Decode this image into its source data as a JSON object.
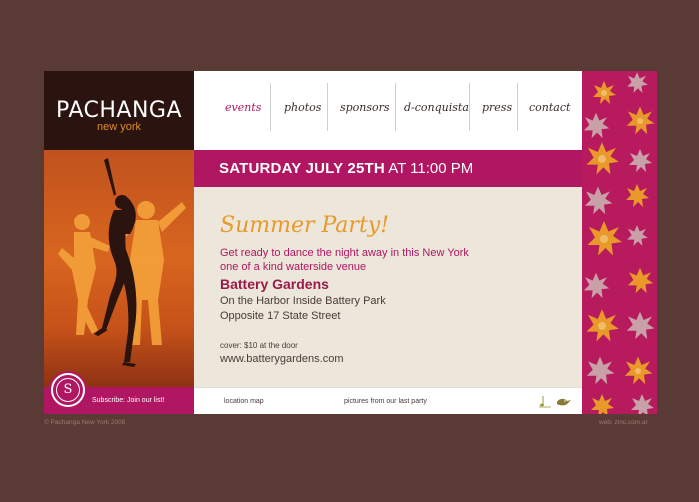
{
  "logo": {
    "title": "PACHANGA",
    "subtitle": "new york"
  },
  "nav": {
    "items": [
      {
        "label": "events"
      },
      {
        "label": "photos"
      },
      {
        "label": "sponsors"
      },
      {
        "label": "d-conquista"
      },
      {
        "label": "press"
      },
      {
        "label": "contact"
      }
    ],
    "active": "events"
  },
  "event": {
    "date": "SATURDAY JULY 25TH",
    "time": "AT 11:00 PM",
    "title": "Summer Party!",
    "intro_line1": "Get ready to dance the night away in this New York",
    "intro_line2": "one of a kind waterside venue",
    "venue": "Battery Gardens",
    "address_line1": "On the Harbor Inside Battery Park",
    "address_line2": "Opposite 17 State Street",
    "cover": "cover: $10 at the door",
    "website": "www.batterygardens.com"
  },
  "subscribe": {
    "badge": "S",
    "label": "Subscribe: Join our list!"
  },
  "links": {
    "location": "location map",
    "pictures": "pictures from our last party"
  },
  "footer": {
    "copyright": "© Pachanga New York 2008",
    "credit": "web: zinc.com.ar"
  },
  "colors": {
    "background": "#5a3a34",
    "accent": "#b01662",
    "orange": "#e8992a",
    "dark": "#2b130f",
    "content_bg": "#ece7da"
  },
  "icons": {
    "subscribe": "s-circle-icon",
    "bird": "bird-icon",
    "note": "music-note-icon"
  }
}
